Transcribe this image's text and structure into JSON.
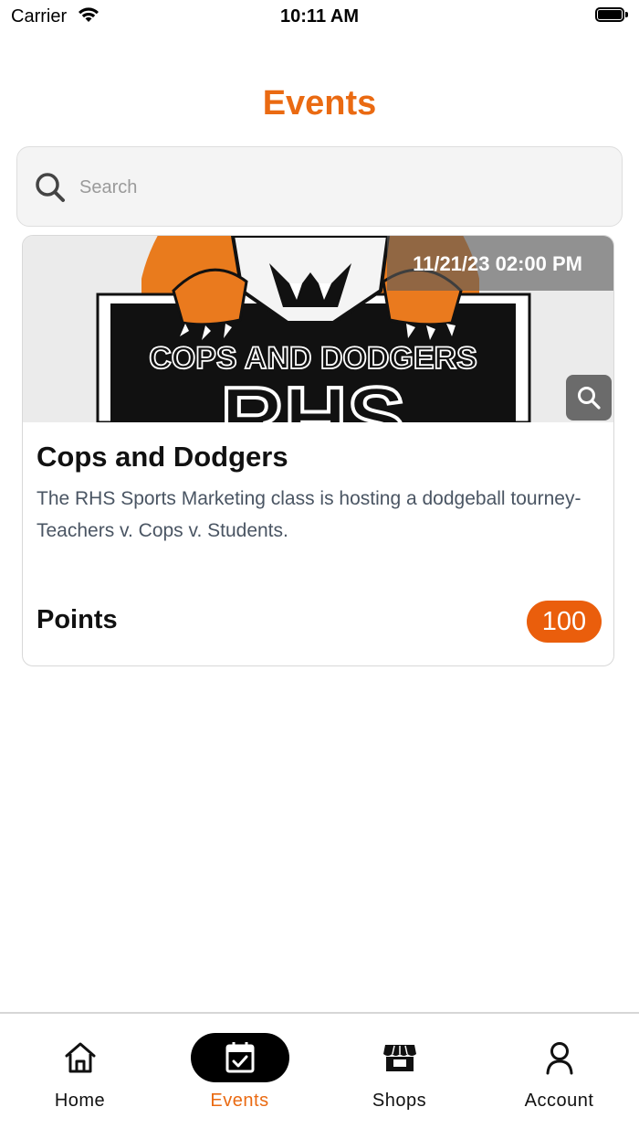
{
  "status_bar": {
    "carrier": "Carrier",
    "time": "10:11 AM"
  },
  "header": {
    "title": "Events"
  },
  "search": {
    "placeholder": "Search",
    "value": ""
  },
  "events": [
    {
      "banner_text": "COPS AND DODGERS",
      "banner_subtext": "RHS",
      "datetime": "11/21/23 02:00 PM",
      "title": "Cops and Dodgers",
      "description": "The RHS Sports Marketing class is hosting a dodgeball tourney- Teachers v. Cops v. Students.",
      "points_label": "Points",
      "points_value": "100"
    }
  ],
  "tabs": [
    {
      "label": "Home",
      "icon": "home-icon",
      "active": false
    },
    {
      "label": "Events",
      "icon": "calendar-check-icon",
      "active": true
    },
    {
      "label": "Shops",
      "icon": "storefront-icon",
      "active": false
    },
    {
      "label": "Account",
      "icon": "person-icon",
      "active": false
    }
  ],
  "colors": {
    "accent": "#ea6a12",
    "badge": "#ea5e0c",
    "active_tab_pill": "#000000",
    "description_text": "#4a5563"
  }
}
